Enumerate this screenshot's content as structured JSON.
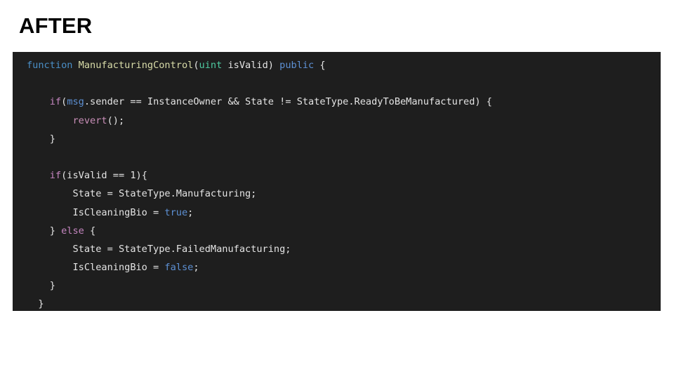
{
  "slide": {
    "background_color": "#ffffff",
    "title": "AFTER"
  },
  "code_block": {
    "background_color": "#1e1e1e",
    "default_text_color": "#e4e4e4",
    "language": "solidity",
    "token_colors": {
      "keyword": "#4a8fc7",
      "function_name": "#d8dba8",
      "type": "#4ec9a0",
      "modifier": "#5d90d4",
      "control": "#c586c0",
      "global": "#5d90d4",
      "method": "#c98fb8",
      "literal": "#5d90d4",
      "plain": "#e4e4e4"
    },
    "lines": [
      {
        "index": 1,
        "text": "function ManufacturingControl(uint isValid) public {",
        "tokens": [
          {
            "t": "function",
            "c": "kw"
          },
          {
            "t": " ",
            "c": "plain"
          },
          {
            "t": "ManufacturingControl",
            "c": "fn"
          },
          {
            "t": "(",
            "c": "plain"
          },
          {
            "t": "uint",
            "c": "type"
          },
          {
            "t": " isValid) ",
            "c": "plain"
          },
          {
            "t": "public",
            "c": "mod"
          },
          {
            "t": " {",
            "c": "plain"
          }
        ]
      },
      {
        "index": 2,
        "text": "",
        "tokens": []
      },
      {
        "index": 3,
        "text": "    if(msg.sender == InstanceOwner && State != StateType.ReadyToBeManufactured) {",
        "tokens": [
          {
            "t": "    ",
            "c": "plain"
          },
          {
            "t": "if",
            "c": "ctrl"
          },
          {
            "t": "(",
            "c": "plain"
          },
          {
            "t": "msg",
            "c": "global"
          },
          {
            "t": ".sender == InstanceOwner && State != StateType.ReadyToBeManufactured) {",
            "c": "plain"
          }
        ]
      },
      {
        "index": 4,
        "text": "        revert();",
        "tokens": [
          {
            "t": "        ",
            "c": "plain"
          },
          {
            "t": "revert",
            "c": "method"
          },
          {
            "t": "();",
            "c": "plain"
          }
        ]
      },
      {
        "index": 5,
        "text": "    }",
        "tokens": [
          {
            "t": "    }",
            "c": "plain"
          }
        ]
      },
      {
        "index": 6,
        "text": "",
        "tokens": []
      },
      {
        "index": 7,
        "text": "    if(isValid == 1){",
        "tokens": [
          {
            "t": "    ",
            "c": "plain"
          },
          {
            "t": "if",
            "c": "ctrl"
          },
          {
            "t": "(isValid == 1){",
            "c": "plain"
          }
        ]
      },
      {
        "index": 8,
        "text": "        State = StateType.Manufacturing;",
        "tokens": [
          {
            "t": "        State = StateType.Manufacturing;",
            "c": "plain"
          }
        ]
      },
      {
        "index": 9,
        "text": "        IsCleaningBio = true;",
        "tokens": [
          {
            "t": "        IsCleaningBio = ",
            "c": "plain"
          },
          {
            "t": "true",
            "c": "lit"
          },
          {
            "t": ";",
            "c": "plain"
          }
        ]
      },
      {
        "index": 10,
        "text": "    } else {",
        "tokens": [
          {
            "t": "    } ",
            "c": "plain"
          },
          {
            "t": "else",
            "c": "ctrl"
          },
          {
            "t": " {",
            "c": "plain"
          }
        ]
      },
      {
        "index": 11,
        "text": "        State = StateType.FailedManufacturing;",
        "tokens": [
          {
            "t": "        State = StateType.FailedManufacturing;",
            "c": "plain"
          }
        ]
      },
      {
        "index": 12,
        "text": "        IsCleaningBio = false;",
        "tokens": [
          {
            "t": "        IsCleaningBio = ",
            "c": "plain"
          },
          {
            "t": "false",
            "c": "lit"
          },
          {
            "t": ";",
            "c": "plain"
          }
        ]
      },
      {
        "index": 13,
        "text": "    }",
        "tokens": [
          {
            "t": "    }",
            "c": "plain"
          }
        ]
      },
      {
        "index": 14,
        "text": "  }",
        "tokens": [
          {
            "t": "  }",
            "c": "plain"
          }
        ]
      }
    ]
  }
}
